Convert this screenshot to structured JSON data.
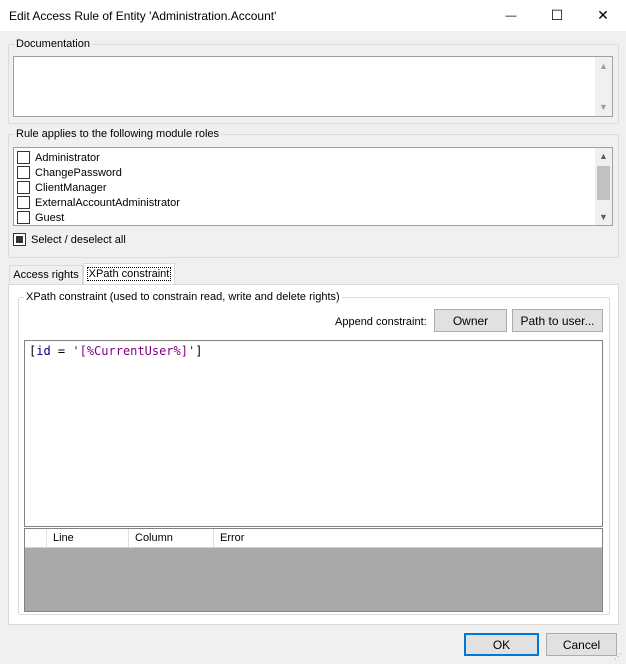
{
  "window": {
    "title": "Edit Access Rule of Entity 'Administration.Account'",
    "minimize_glyph": "—",
    "maximize_glyph": "☐",
    "close_glyph": "✕"
  },
  "documentation": {
    "legend": "Documentation",
    "value": ""
  },
  "roles": {
    "legend": "Rule applies to the following module roles",
    "items": [
      {
        "label": "Administrator",
        "checked": false
      },
      {
        "label": "ChangePassword",
        "checked": false
      },
      {
        "label": "ClientManager",
        "checked": false
      },
      {
        "label": "ExternalAccountAdministrator",
        "checked": false
      },
      {
        "label": "Guest",
        "checked": false
      }
    ],
    "select_all_label": "Select / deselect all"
  },
  "tabs": [
    {
      "label": "Access rights",
      "active": false
    },
    {
      "label": "XPath constraint",
      "active": true
    }
  ],
  "xpath": {
    "legend": "XPath constraint (used to constrain read, write and delete rights)",
    "append_label": "Append constraint:",
    "owner_button": "Owner",
    "path_button": "Path to user...",
    "code": {
      "open": "[",
      "attr": "id",
      "eq": " = ",
      "str": "'[%CurrentUser%]'",
      "close": "]"
    }
  },
  "error_grid": {
    "columns": [
      "Line",
      "Column",
      "Error"
    ]
  },
  "footer": {
    "ok_label": "OK",
    "cancel_label": "Cancel"
  },
  "colors": {
    "accent_border": "#0078d7",
    "string": "#7f007f",
    "identifier": "#00007f",
    "grid_bg": "#a9a9a9"
  }
}
